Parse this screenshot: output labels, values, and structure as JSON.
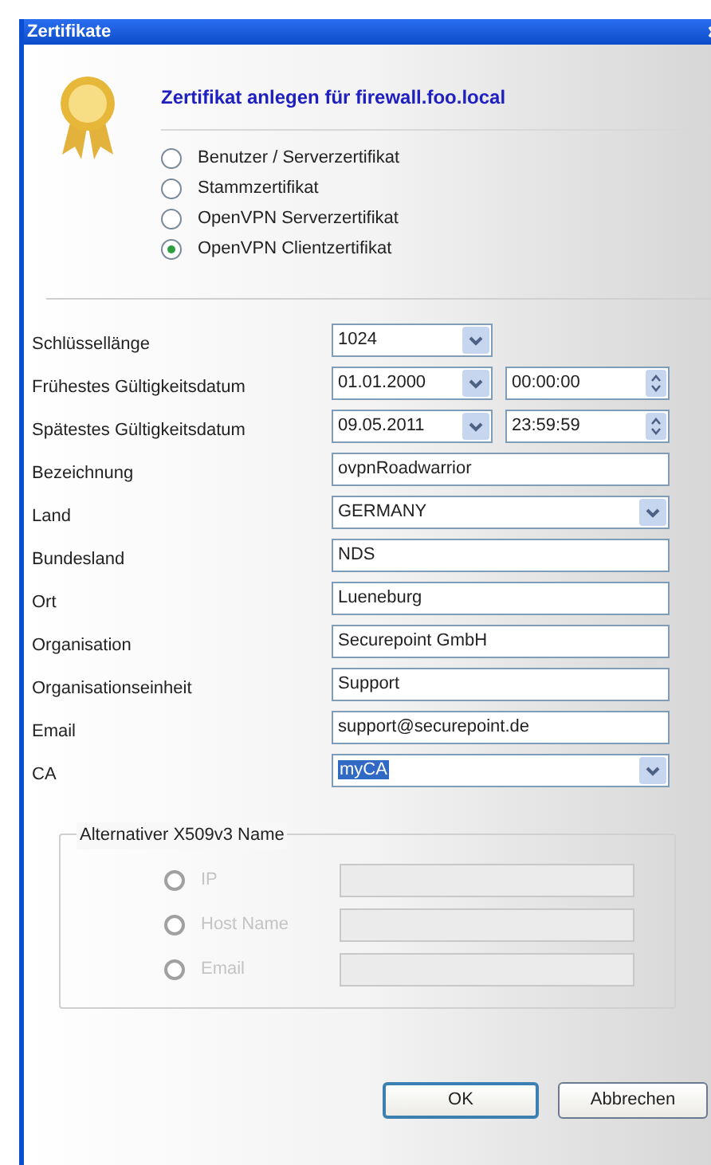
{
  "window": {
    "title": "Zertifikate"
  },
  "heading": "Zertifikat anlegen für firewall.foo.local",
  "types": [
    {
      "label": "Benutzer / Serverzertifikat",
      "selected": false
    },
    {
      "label": "Stammzertifikat",
      "selected": false
    },
    {
      "label": "OpenVPN Serverzertifikat",
      "selected": false
    },
    {
      "label": "OpenVPN Clientzertifikat",
      "selected": true
    }
  ],
  "fields": [
    {
      "kind": "combo",
      "label": "Schlüssellänge",
      "value": "1024",
      "wide": false
    },
    {
      "kind": "datetime",
      "label": "Frühestes Gültigkeitsdatum",
      "date": "01.01.2000",
      "time": "00:00:00"
    },
    {
      "kind": "datetime",
      "label": "Spätestes Gültigkeitsdatum",
      "date": "09.05.2011",
      "time": "23:59:59"
    },
    {
      "kind": "text",
      "label": "Bezeichnung",
      "value": "ovpnRoadwarrior"
    },
    {
      "kind": "combo",
      "label": "Land",
      "value": "GERMANY",
      "wide": true
    },
    {
      "kind": "text",
      "label": "Bundesland",
      "value": "NDS"
    },
    {
      "kind": "text",
      "label": "Ort",
      "value": "Lueneburg"
    },
    {
      "kind": "text",
      "label": "Organisation",
      "value": "Securepoint GmbH"
    },
    {
      "kind": "text",
      "label": "Organisationseinheit",
      "value": "Support"
    },
    {
      "kind": "text",
      "label": "Email",
      "value": "support@securepoint.de"
    },
    {
      "kind": "combo",
      "label": "CA",
      "value": "myCA",
      "wide": true,
      "highlighted": true
    }
  ],
  "alt_name": {
    "title": "Alternativer X509v3 Name",
    "options": [
      {
        "label": "IP",
        "selected": false,
        "disabled": true
      },
      {
        "label": "Host Name",
        "selected": false,
        "disabled": true
      },
      {
        "label": "Email",
        "selected": false,
        "disabled": true
      }
    ]
  },
  "buttons": [
    {
      "label": "OK",
      "default": true
    },
    {
      "label": "Abbrechen",
      "default": false
    }
  ]
}
